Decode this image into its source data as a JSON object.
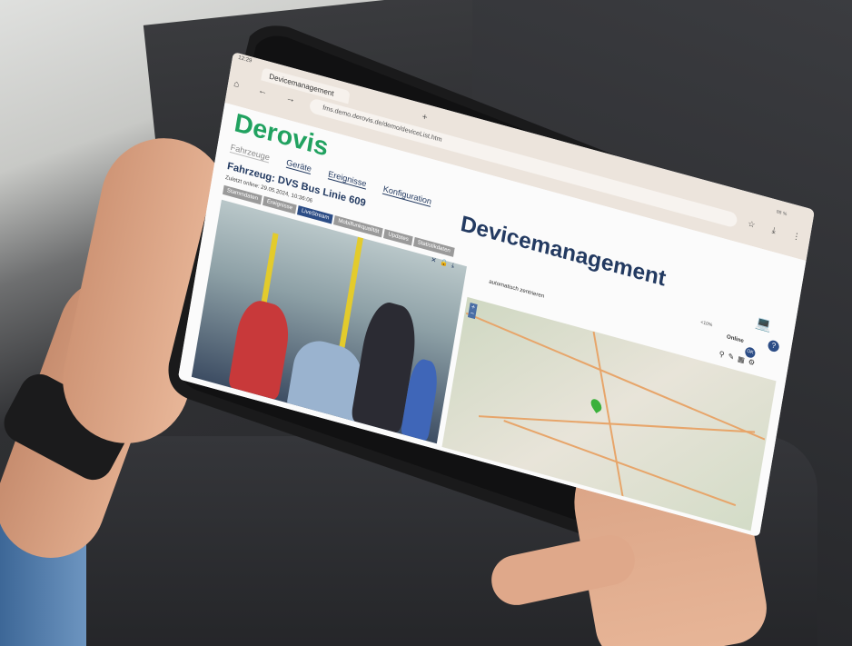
{
  "browser": {
    "clock": "12:29",
    "tab_title": "Devicemanagement",
    "new_tab_icon": "+",
    "nav_icons": "⌂ ← → C",
    "url": "fms.demo.derovis.de/demo/deviceList.htm",
    "status_text": "88 %",
    "toolbar_icons": "☆ ⤓ ⋮"
  },
  "page": {
    "logo": "Derovis",
    "menu": [
      "Fahrzeuge",
      "Geräte",
      "Ereignisse",
      "Konfiguration"
    ],
    "title": "Devicemanagement",
    "vehicle": "Fahrzeug: DVS Bus Linie 609",
    "last_online": "Zuletzt online: 29.05.2024, 10:36:06",
    "subtabs": [
      "Stammdaten",
      "Ereignisse",
      "LiveStream",
      "Mobilfunkqualität",
      "Updates",
      "Statistikdaten"
    ],
    "active_subtab": "LiveStream",
    "auto_center": "automatisch zentrieren",
    "signal": "<10%",
    "online": "Online",
    "ok_badge": "OK",
    "help": "?"
  },
  "colors": {
    "brand_green": "#21a260",
    "navy": "#233a61",
    "active_tab": "#2c4d86"
  }
}
